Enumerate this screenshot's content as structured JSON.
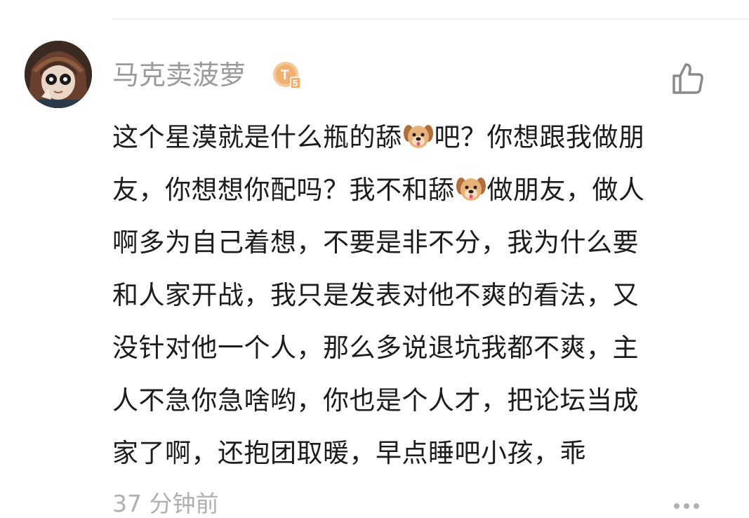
{
  "comment": {
    "username": "马克卖菠萝",
    "badge_text": "T5",
    "lines": [
      [
        "这个星漠就是什么瓶的舔",
        "dog",
        "吧？你想跟我做朋"
      ],
      [
        "友，你想想你配吗？我不和舔",
        "dog",
        "做朋友，做人"
      ],
      [
        "啊多为自己着想，不要是非不分，我为什么要"
      ],
      [
        "和人家开战，我只是发表对他不爽的看法，又"
      ],
      [
        "没针对他一个人，那么多说退坑我都不爽，主"
      ],
      [
        "人不急你急啥哟，你也是个人才，把论坛当成"
      ],
      [
        "家了啊，还抱团取暖，早点睡吧小孩，乖"
      ]
    ],
    "timestamp": "37 分钟前"
  },
  "icons": {
    "avatar": "avatar",
    "badge": "level-badge-icon",
    "like": "thumbs-up-icon",
    "more": "more-options-icon",
    "emoji": "dog-face-emoji"
  },
  "colors": {
    "username": "#9a9a9a",
    "body_text": "#1c1c1c",
    "timestamp": "#b0b0b0",
    "badge": "#f0b070",
    "icon": "#8a8a8a"
  }
}
